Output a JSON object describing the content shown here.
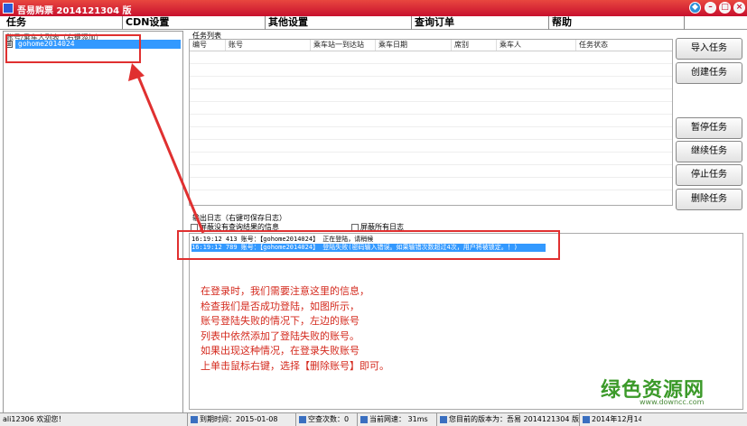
{
  "window": {
    "title": "吾易购票 2014121304 版"
  },
  "menu": [
    "任务",
    "CDN设置",
    "其他设置",
    "查询订单",
    "帮助"
  ],
  "left_panel": {
    "caption": "账号/乘车人列表（右键添加）",
    "tree_toggle": "⊞",
    "account": "gohome2014024"
  },
  "task_list": {
    "caption": "任务列表",
    "columns": [
      "编号",
      "账号",
      "乘车站一到达站",
      "乘车日期",
      "席别",
      "乘车人",
      "任务状态"
    ]
  },
  "buttons": {
    "import": "导入任务",
    "create": "创建任务",
    "pause": "暂停任务",
    "resume": "继续任务",
    "stop": "停止任务",
    "delete": "删除任务"
  },
  "log": {
    "caption": "输出日志（右键可保存日志）",
    "filter_no_result": "屏蔽没有查询结果的信息",
    "filter_all": "屏蔽所有日志",
    "lines": [
      "16:19:12 413    账号：【gohome2014024】 正在登陆，请稍候",
      "16:19:12 789    账号：【gohome2014024】 登陆失败(密码输入错误。如果输错次数超过4次，用户将被锁定。！)"
    ]
  },
  "annotation": [
    "在登录时，我们需要注意这里的信息，",
    "检查我们是否成功登陆，如图所示，",
    "账号登陆失败的情况下，左边的账号",
    "列表中依然添加了登陆失败的账号。",
    "如果出现这种情况，在登录失败账号",
    "上单击鼠标右键，选择【删除账号】即可。"
  ],
  "watermark": {
    "logo": "绿色资源网",
    "url": "www.downcc.com"
  },
  "status": {
    "user": "ali12306 欢迎您！",
    "expire": "到期时间：2015-01-08",
    "empty_count": "空查次数：0",
    "speed_label": "当前网速：",
    "speed_value": "31ms",
    "version": "您目前的版本为：吾易 2014121304 版",
    "date": "2014年12月14"
  },
  "colors": {
    "titlebar": "#c8102e",
    "selection": "#3399ff",
    "annotation": "#d42a1e",
    "highlight_box": "#e03030"
  }
}
